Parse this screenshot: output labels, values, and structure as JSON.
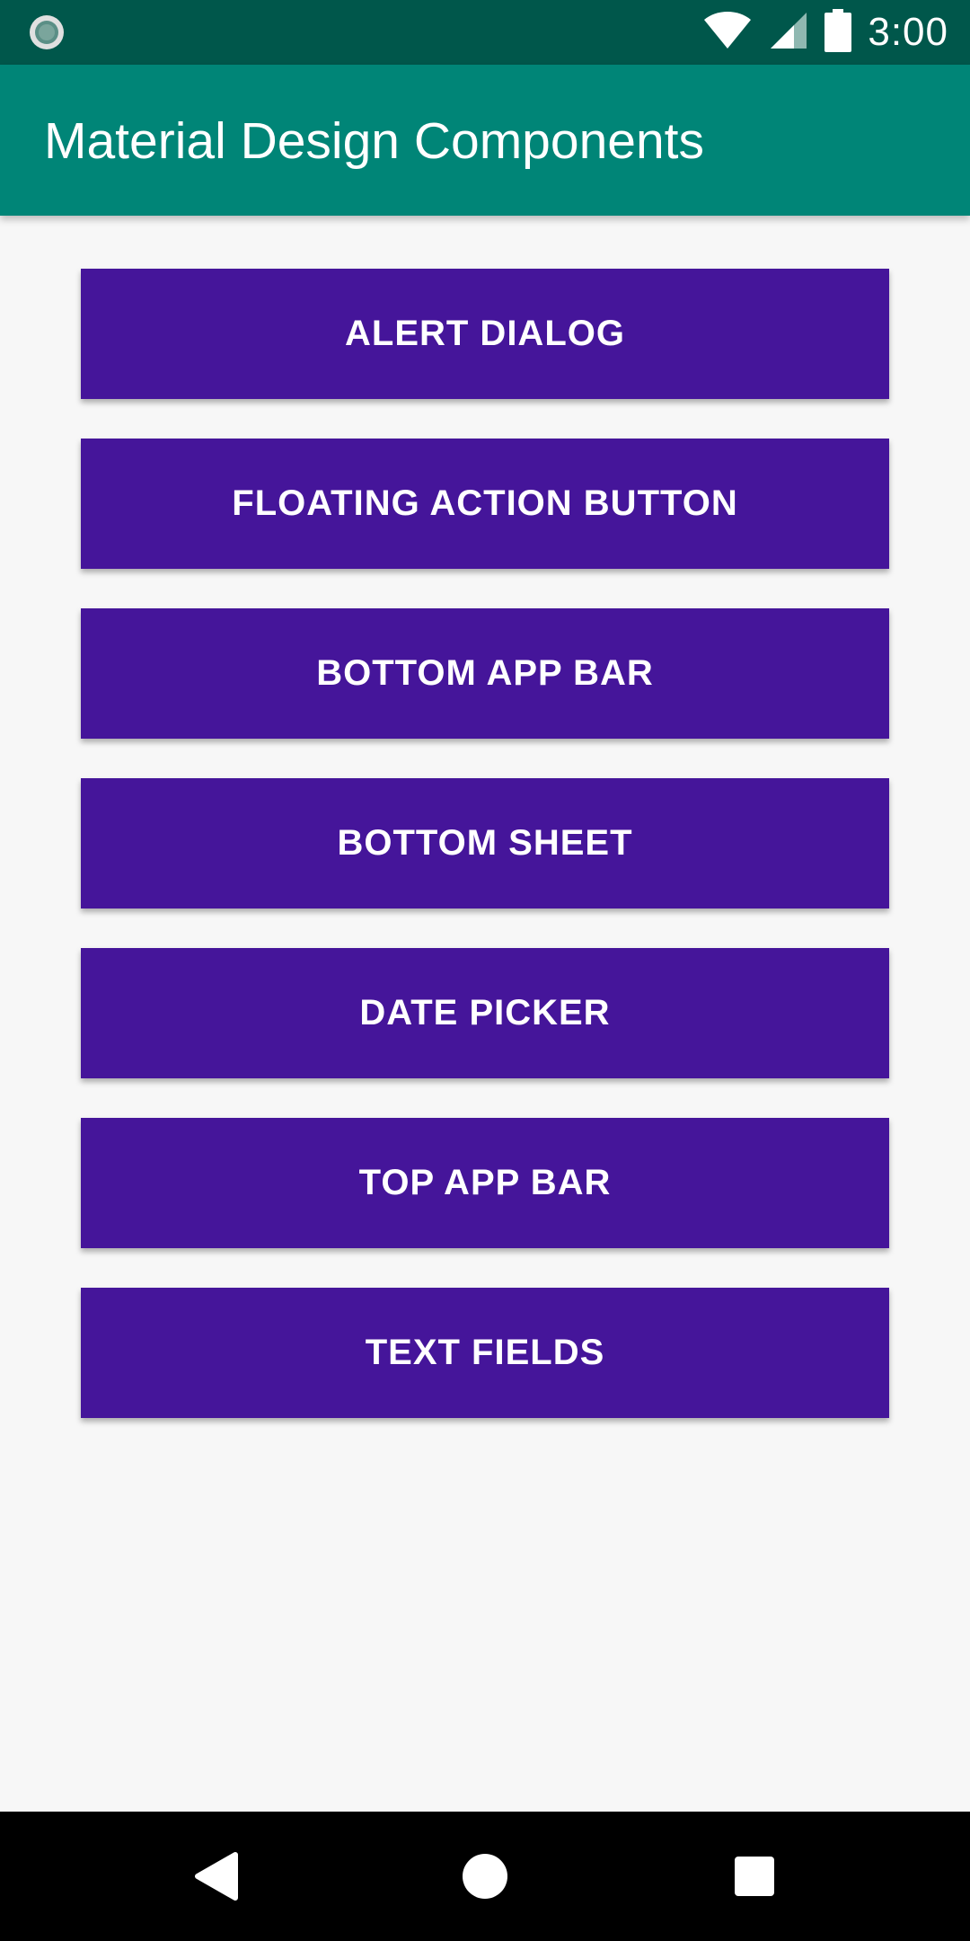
{
  "status_bar": {
    "time": "3:00",
    "icons": [
      "notification-dot-icon",
      "wifi-icon",
      "cell-signal-icon",
      "battery-icon"
    ]
  },
  "app_bar": {
    "title": "Material Design Components"
  },
  "buttons": [
    {
      "label": "ALERT DIALOG"
    },
    {
      "label": "FLOATING ACTION BUTTON"
    },
    {
      "label": "BOTTOM APP BAR"
    },
    {
      "label": "BOTTOM SHEET"
    },
    {
      "label": "DATE PICKER"
    },
    {
      "label": "TOP APP BAR"
    },
    {
      "label": "TEXT FIELDS"
    }
  ],
  "nav_bar": {
    "icons": [
      "back-icon",
      "home-icon",
      "recents-icon"
    ]
  },
  "colors": {
    "status_bar": "#00574b",
    "app_bar": "#008577",
    "button": "#45159a",
    "background": "#f7f7f7"
  }
}
